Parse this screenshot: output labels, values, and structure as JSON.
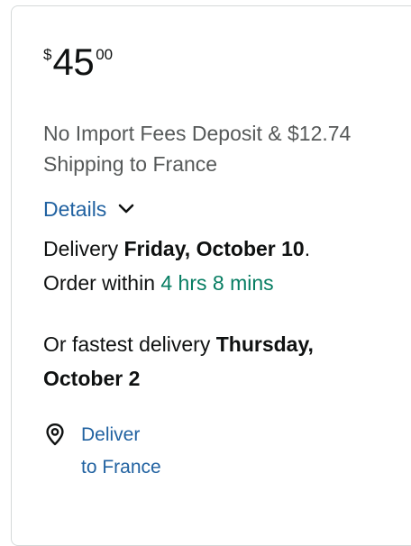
{
  "price": {
    "symbol": "$",
    "whole": "45",
    "fraction": "00"
  },
  "shipping": {
    "text": "No Import Fees Deposit & $12.74 Shipping to France"
  },
  "details": {
    "label": "Details",
    "icon": "chevron-down-icon"
  },
  "delivery": {
    "prefix": "Delivery ",
    "date": "Friday, October 10",
    "suffix": ".",
    "order_prefix": "Order within ",
    "countdown": "4 hrs 8 mins",
    "countdown_color": "#067d62"
  },
  "fastest": {
    "prefix": "Or fastest delivery ",
    "date": "Thursday, October 2"
  },
  "location": {
    "icon": "location-pin-icon",
    "line1": "Deliver",
    "line2": "to France",
    "link_color": "#2162a1"
  }
}
